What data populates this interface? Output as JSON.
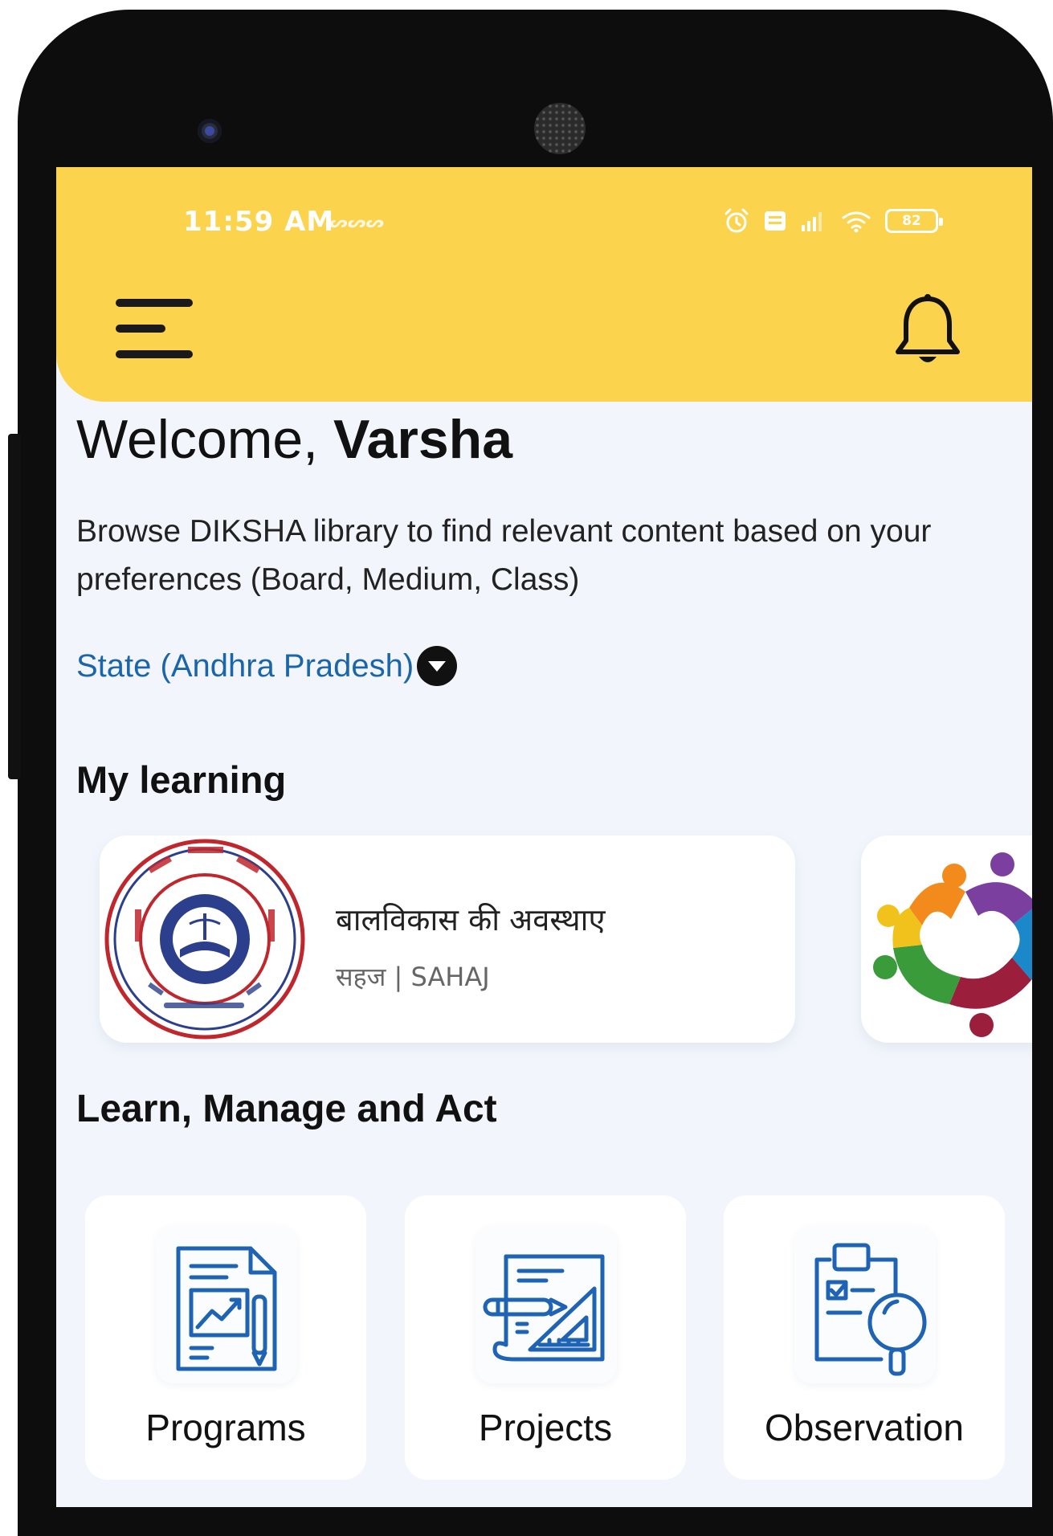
{
  "status_bar": {
    "time": "11:59 AM",
    "extra": "ᔕᔕᔕ",
    "battery": "82"
  },
  "header": {
    "menu_icon": "hamburger-menu-icon",
    "notification_icon": "bell-icon"
  },
  "welcome": {
    "greeting": "Welcome, ",
    "name": "Varsha"
  },
  "intro_text": "Browse DIKSHA library to find relevant content based on your preferences (Board, Medium, Class)",
  "board_selector": {
    "label": "State (Andhra Pradesh)",
    "icon": "dropdown-caret-icon"
  },
  "my_learning": {
    "title": "My learning",
    "courses": [
      {
        "title": "बालविकास की अवस्थाए",
        "subtitle": "सहज | SAHAJ",
        "logo": "scert-uttar-pradesh-seal"
      },
      {
        "logo": "community-circle-logo"
      }
    ]
  },
  "learn_manage_act": {
    "title": "Learn, Manage and Act",
    "items": [
      {
        "label": "Programs",
        "icon": "programs-document-chart-icon"
      },
      {
        "label": "Projects",
        "icon": "projects-blueprint-icon"
      },
      {
        "label": "Observation",
        "icon": "observation-clipboard-magnifier-icon"
      }
    ]
  },
  "colors": {
    "header_bg": "#fcd34d",
    "screen_bg": "#f2f6fc",
    "link_blue": "#1b66a8",
    "icon_blue": "#1e63b4"
  }
}
